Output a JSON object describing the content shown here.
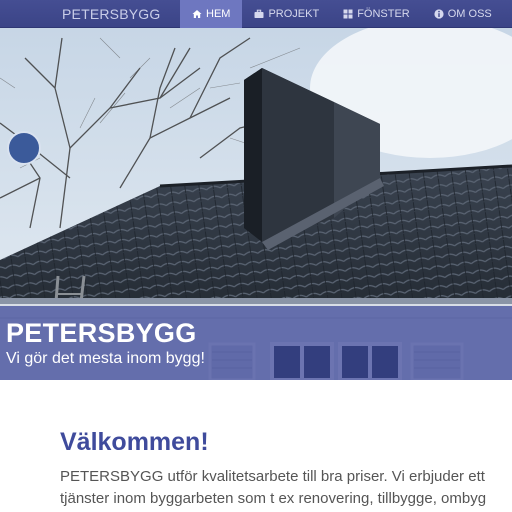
{
  "navbar": {
    "brand": "PETERSBYGG",
    "items": [
      {
        "label": "HEM",
        "icon": "home-icon",
        "active": true
      },
      {
        "label": "PROJEKT",
        "icon": "briefcase-icon",
        "active": false
      },
      {
        "label": "FÖNSTER",
        "icon": "grid-icon",
        "active": false
      },
      {
        "label": "OM OSS",
        "icon": "info-icon",
        "active": false
      }
    ]
  },
  "hero": {
    "title": "PETERSBYGG",
    "subtitle": "Vi gör det mesta inom bygg!"
  },
  "main": {
    "heading": "Välkommen!",
    "intro_line1": "PETERSBYGG utför kvalitetsarbete till bra priser. Vi erbjuder ett",
    "intro_line2": "tjänster inom byggarbeten som t ex renovering, tillbygge, ombyg"
  },
  "colors": {
    "navbar": "#3f488b",
    "nav_active": "#6e77c0",
    "accent": "#3f4b9c",
    "hero_band": "#3842968c"
  }
}
